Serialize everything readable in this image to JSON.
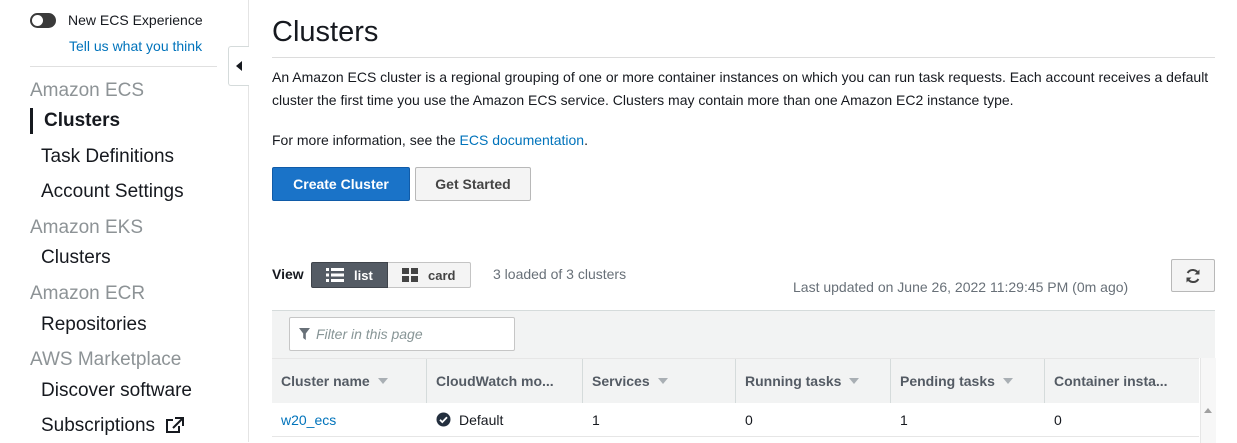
{
  "sidebar": {
    "toggle_label": "New ECS Experience",
    "feedback_link": "Tell us what you think",
    "sections": [
      {
        "title": "Amazon ECS",
        "items": [
          "Clusters",
          "Task Definitions",
          "Account Settings"
        ]
      },
      {
        "title": "Amazon EKS",
        "items": [
          "Clusters"
        ]
      },
      {
        "title": "Amazon ECR",
        "items": [
          "Repositories"
        ]
      },
      {
        "title": "AWS Marketplace",
        "items": [
          "Discover software",
          "Subscriptions"
        ]
      }
    ],
    "active_item": "Clusters"
  },
  "page": {
    "title": "Clusters",
    "description": "An Amazon ECS cluster is a regional grouping of one or more container instances on which you can run task requests. Each account receives a default cluster the first time you use the Amazon ECS service. Clusters may contain more than one Amazon EC2 instance type.",
    "more_info_prefix": "For more information, see the ",
    "more_info_link": "ECS documentation",
    "more_info_suffix": "."
  },
  "actions": {
    "create_cluster": "Create Cluster",
    "get_started": "Get Started"
  },
  "view": {
    "label": "View",
    "list": "list",
    "card": "card",
    "loaded_text": "3 loaded of 3 clusters",
    "last_updated": "Last updated on June 26, 2022 11:29:45 PM (0m ago)"
  },
  "table": {
    "filter_placeholder": "Filter in this page",
    "columns": [
      "Cluster name",
      "CloudWatch mo...",
      "Services",
      "Running tasks",
      "Pending tasks",
      "Container insta..."
    ],
    "rows": [
      {
        "name": "w20_ecs",
        "cloudwatch": "Default",
        "services": "1",
        "running": "0",
        "pending": "1",
        "instances": "0"
      }
    ]
  },
  "colors": {
    "primary": "#1a73c8",
    "link": "#0073bb",
    "muted": "#687078"
  },
  "icons": [
    "toggle-switch-icon",
    "collapse-arrow-icon",
    "external-link-icon",
    "list-icon",
    "grid-icon",
    "refresh-icon",
    "filter-icon",
    "sort-caret-icon",
    "check-circle-icon"
  ]
}
